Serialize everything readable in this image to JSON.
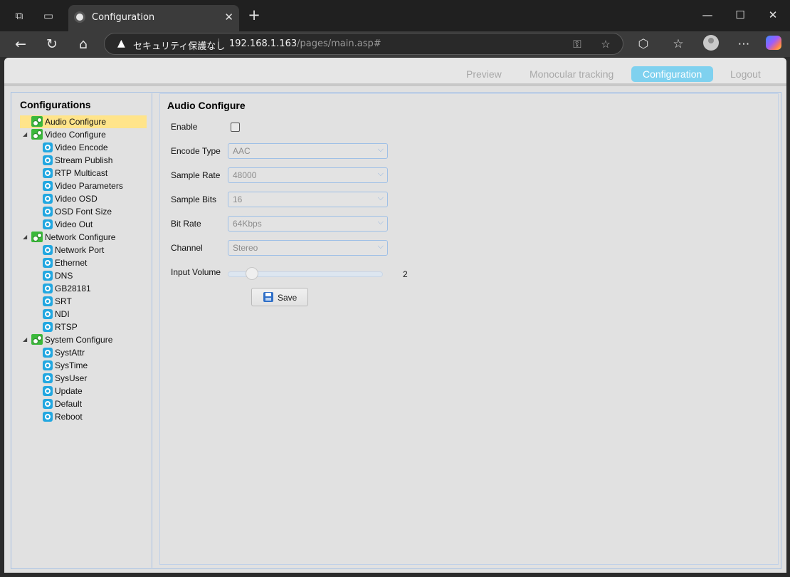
{
  "browser": {
    "tab_title": "Configuration",
    "tab_close": "✕",
    "new_tab": "+",
    "security_warning": "セキュリティ保護なし",
    "url_host": "192.168.1.163",
    "url_path": "/pages/main.asp#",
    "icons": [
      "workspaces-icon",
      "tab-actions-icon",
      "back-icon",
      "refresh-icon",
      "home-icon",
      "key-icon",
      "favorite-star-icon",
      "extensions-icon",
      "favorites-icon",
      "profile-icon",
      "more-icon",
      "copilot-icon"
    ]
  },
  "topnav": {
    "items": [
      {
        "label": "Preview",
        "active": false
      },
      {
        "label": "Monocular tracking",
        "active": false
      },
      {
        "label": "Configuration",
        "active": true
      },
      {
        "label": "Logout",
        "active": false
      }
    ],
    "active_color": "#7fd1ef"
  },
  "sidebar": {
    "title": "Configurations",
    "tree": [
      {
        "label": "Audio Configure",
        "level": 0,
        "selected": true
      },
      {
        "label": "Video Configure",
        "level": 0,
        "expandable": true
      },
      {
        "label": "Video Encode",
        "level": 1
      },
      {
        "label": "Stream Publish",
        "level": 1
      },
      {
        "label": "RTP Multicast",
        "level": 1
      },
      {
        "label": "Video Parameters",
        "level": 1
      },
      {
        "label": "Video OSD",
        "level": 1
      },
      {
        "label": "OSD Font Size",
        "level": 1
      },
      {
        "label": "Video Out",
        "level": 1
      },
      {
        "label": "Network Configure",
        "level": 0,
        "expandable": true
      },
      {
        "label": "Network Port",
        "level": 1
      },
      {
        "label": "Ethernet",
        "level": 1
      },
      {
        "label": "DNS",
        "level": 1
      },
      {
        "label": "GB28181",
        "level": 1
      },
      {
        "label": "SRT",
        "level": 1
      },
      {
        "label": "NDI",
        "level": 1
      },
      {
        "label": "RTSP",
        "level": 1
      },
      {
        "label": "System Configure",
        "level": 0,
        "expandable": true
      },
      {
        "label": "SystAttr",
        "level": 1
      },
      {
        "label": "SysTime",
        "level": 1
      },
      {
        "label": "SysUser",
        "level": 1
      },
      {
        "label": "Update",
        "level": 1
      },
      {
        "label": "Default",
        "level": 1
      },
      {
        "label": "Reboot",
        "level": 1
      }
    ]
  },
  "audio": {
    "title": "Audio Configure",
    "enable_label": "Enable",
    "enable_checked": false,
    "fields": [
      {
        "label": "Encode Type",
        "value": "AAC"
      },
      {
        "label": "Sample Rate",
        "value": "48000"
      },
      {
        "label": "Sample Bits",
        "value": "16"
      },
      {
        "label": "Bit Rate",
        "value": "64Kbps"
      },
      {
        "label": "Channel",
        "value": "Stereo"
      }
    ],
    "volume_label": "Input Volume",
    "volume_value": "2",
    "save_label": "Save"
  }
}
